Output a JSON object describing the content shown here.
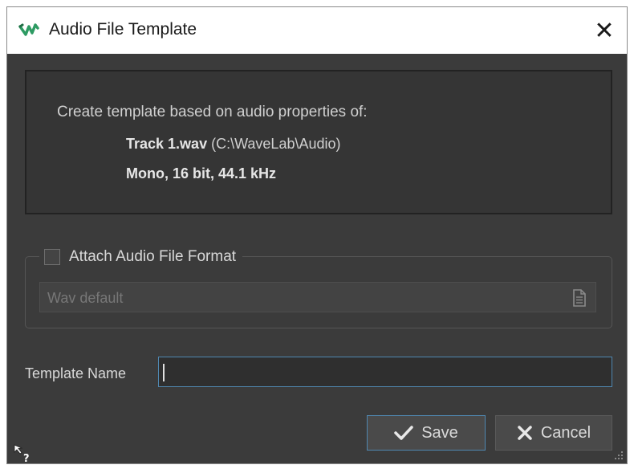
{
  "window": {
    "title": "Audio File Template",
    "close_glyph": "✕",
    "accent": "#4f87b0"
  },
  "info": {
    "heading": "Create template based on audio properties of:",
    "file_name": "Track 1.wav",
    "file_path": "(C:\\WaveLab\\Audio)",
    "format": "Mono, 16 bit, 44.1 kHz"
  },
  "attach": {
    "label": "Attach Audio File Format",
    "checked": false,
    "format_value": "Wav default",
    "icon": "document-icon"
  },
  "template_name": {
    "label": "Template Name",
    "value": ""
  },
  "buttons": {
    "save_label": "Save",
    "cancel_label": "Cancel"
  },
  "icons": {
    "app": "wavelab-logo-icon",
    "help": "context-help-icon",
    "resize": "resize-grip-icon"
  }
}
